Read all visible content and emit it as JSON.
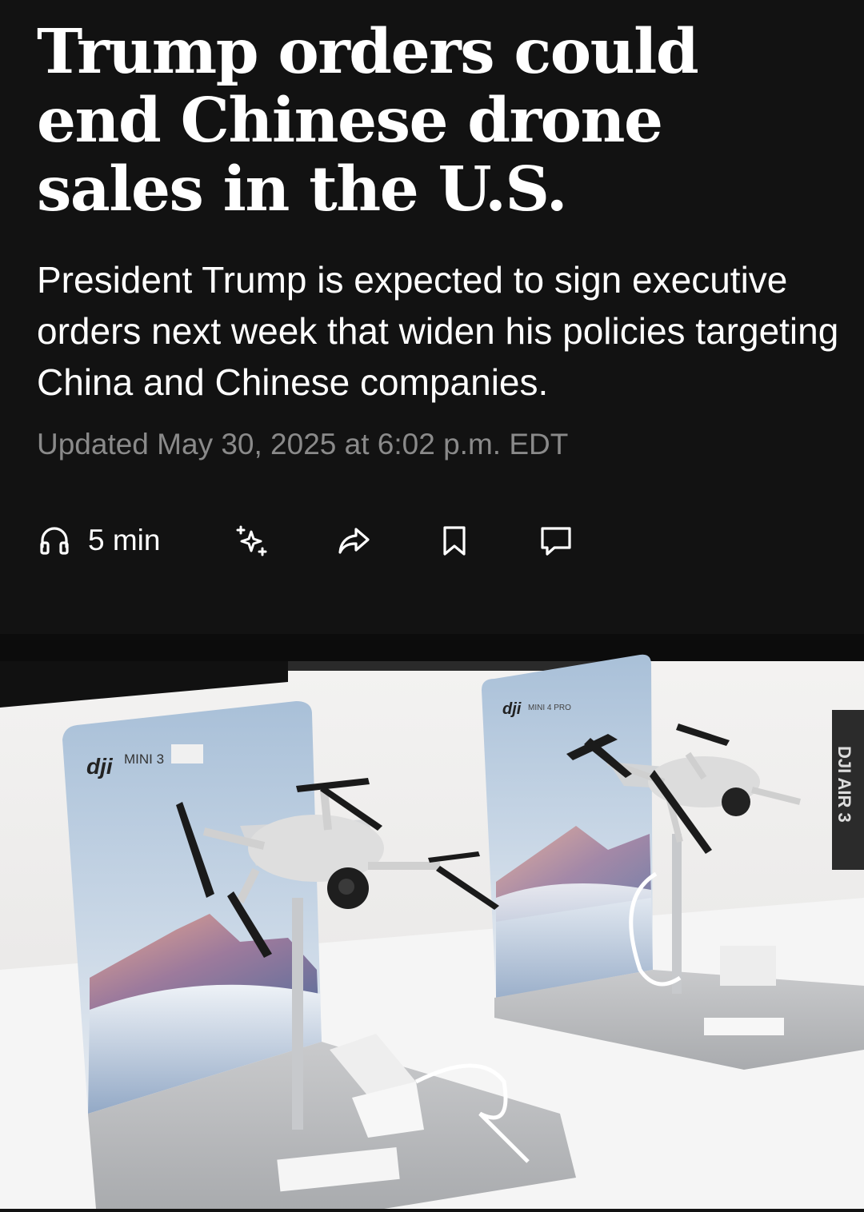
{
  "article": {
    "headline": "Trump orders could end Chinese drone sales in the U.S.",
    "dek": "President Trump is expected to sign executive orders next week that widen his policies targeting China and Chinese companies.",
    "timestamp": "Updated May 30, 2025 at 6:02 p.m. EDT"
  },
  "actions": {
    "listen": {
      "icon": "headphones-icon",
      "label": "5 min"
    },
    "summarize": {
      "icon": "sparkle-icon"
    },
    "share": {
      "icon": "share-arrow-icon"
    },
    "save": {
      "icon": "bookmark-icon"
    },
    "comments": {
      "icon": "comment-icon"
    }
  },
  "hero_image": {
    "display_left_brand": "dji",
    "display_left_model": "MINI 3",
    "display_right_brand": "dji",
    "display_right_model": "MINI 4 PRO",
    "side_sign": "DJI AIR 3",
    "colors": {
      "background": "#121212",
      "text": "#ffffff",
      "timestamp": "#8a8a8a"
    }
  }
}
